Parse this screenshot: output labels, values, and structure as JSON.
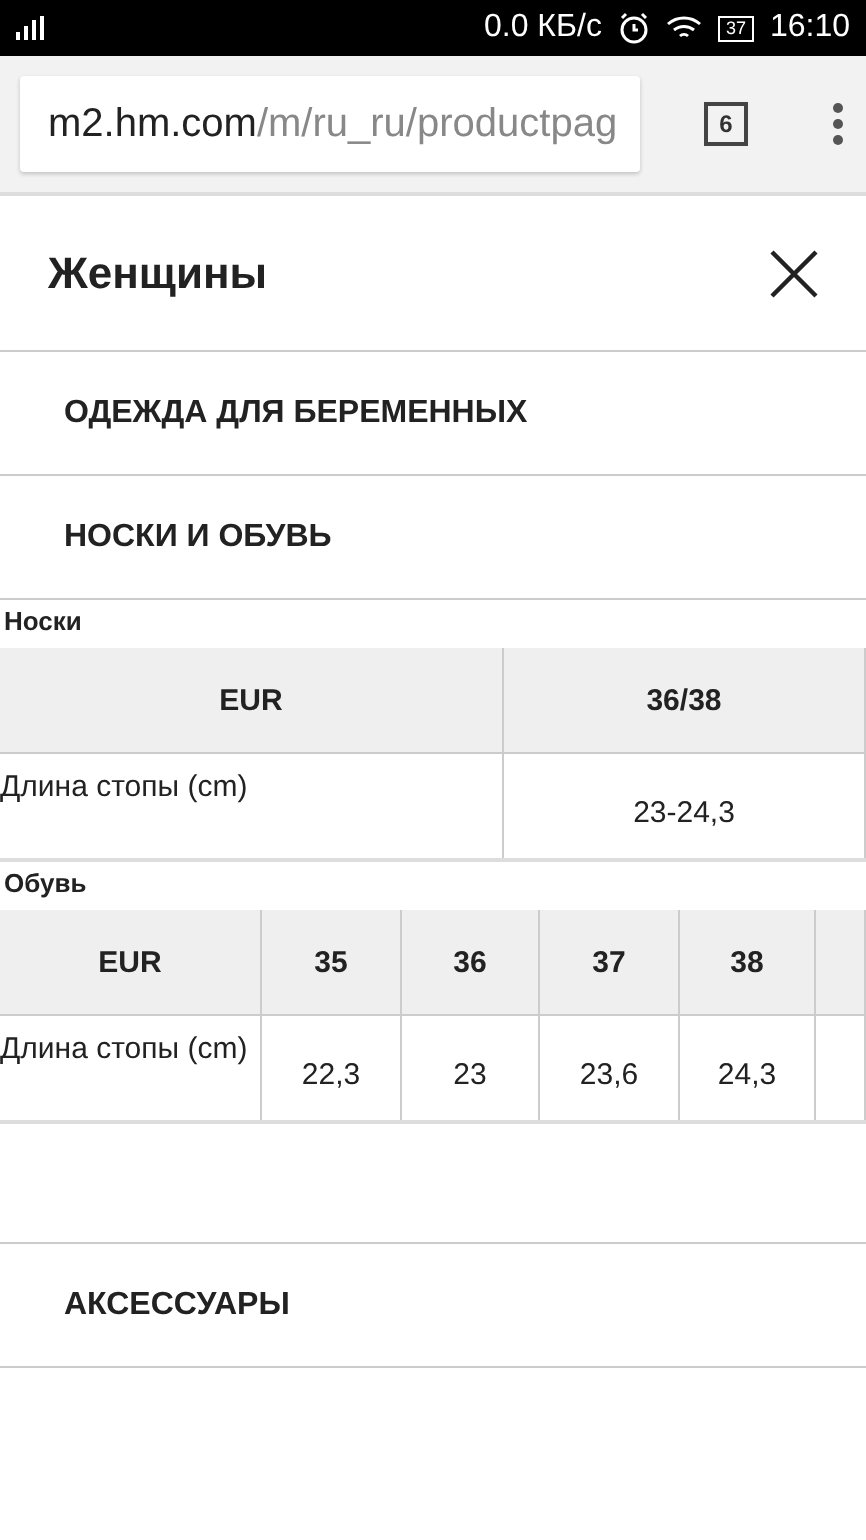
{
  "status_bar": {
    "speed": "0.0 КБ/с",
    "battery": "37",
    "time": "16:10"
  },
  "browser": {
    "url_host": "m2.hm.com",
    "url_path": "/m/ru_ru/productpag",
    "tab_count": "6"
  },
  "menu": {
    "title": "Женщины",
    "items_top": [
      {
        "label": "ОДЕЖДА ДЛЯ БЕРЕМЕННЫХ"
      },
      {
        "label": "НОСКИ И ОБУВЬ"
      }
    ],
    "tables": [
      {
        "title": "Носки",
        "header": [
          "EUR",
          "36/38"
        ],
        "row": [
          "Длина стопы (cm)",
          "23-24,3"
        ]
      },
      {
        "title": "Обувь",
        "header": [
          "EUR",
          "35",
          "36",
          "37",
          "38"
        ],
        "row": [
          "Длина стопы (cm)",
          "22,3",
          "23",
          "23,6",
          "24,3"
        ]
      }
    ],
    "items_bottom": [
      {
        "label": "АКСЕССУАРЫ"
      }
    ]
  }
}
